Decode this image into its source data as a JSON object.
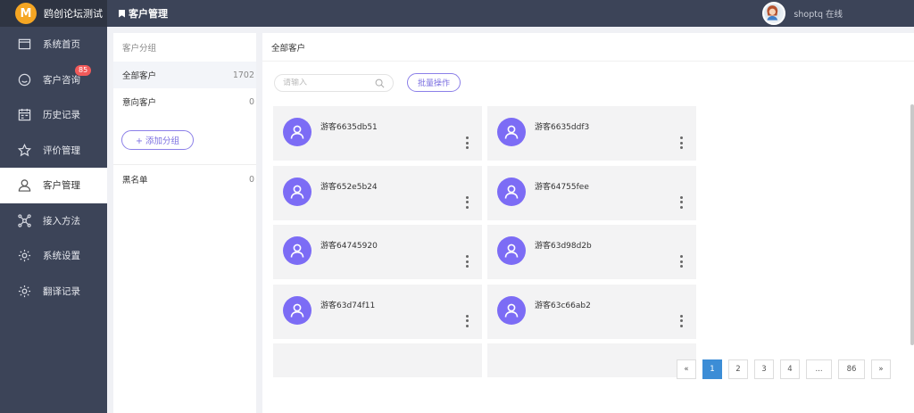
{
  "brand": {
    "name": "鸥创论坛测试",
    "logo_letter": "M"
  },
  "topbar": {
    "title": "客户管理",
    "user_status": "shoptq 在线"
  },
  "sidebar": {
    "items": [
      {
        "label": "系统首页",
        "icon": "window-icon"
      },
      {
        "label": "客户咨询",
        "icon": "smile-icon",
        "badge": "85"
      },
      {
        "label": "历史记录",
        "icon": "calendar-icon"
      },
      {
        "label": "评价管理",
        "icon": "star-icon"
      },
      {
        "label": "客户管理",
        "icon": "user-icon",
        "active": true
      },
      {
        "label": "接入方法",
        "icon": "network-icon"
      },
      {
        "label": "系统设置",
        "icon": "gear-icon"
      },
      {
        "label": "翻译记录",
        "icon": "gear-icon"
      }
    ]
  },
  "groups": {
    "header": "客户分组",
    "items": [
      {
        "label": "全部客户",
        "count": "1702"
      },
      {
        "label": "意向客户",
        "count": "0"
      }
    ],
    "add_label": "+ 添加分组",
    "blacklist": {
      "label": "黑名单",
      "count": "0"
    }
  },
  "main": {
    "header": "全部客户",
    "search_placeholder": "请输入",
    "batch_label": "批量操作",
    "customers": [
      "游客6635db51",
      "游客6635ddf3",
      "游客652e5b24",
      "游客64755fee",
      "游客64745920",
      "游客63d98d2b",
      "游客63d74f11",
      "游客63c66ab2"
    ]
  },
  "pagination": {
    "prev": "«",
    "pages": [
      "1",
      "2",
      "3",
      "4"
    ],
    "ellipsis": "...",
    "last": "86",
    "next": "»",
    "current": "1"
  },
  "colors": {
    "sidebar": "#3c4458",
    "accent": "#7c6cf5",
    "badge": "#f25a5a",
    "page_active": "#3c8dd6"
  }
}
